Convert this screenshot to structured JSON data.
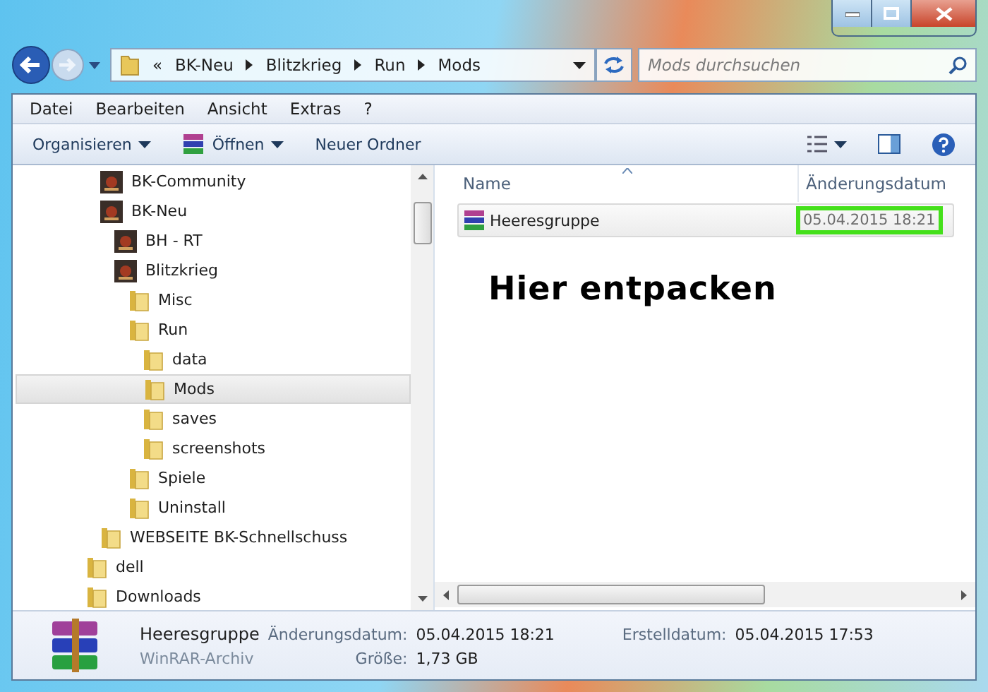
{
  "address_bar": {
    "overflow": "«",
    "crumbs": [
      "BK-Neu",
      "Blitzkrieg",
      "Run",
      "Mods"
    ]
  },
  "search": {
    "placeholder": "Mods durchsuchen"
  },
  "menu": [
    "Datei",
    "Bearbeiten",
    "Ansicht",
    "Extras",
    "?"
  ],
  "toolbar": [
    {
      "label": "Organisieren",
      "kind": "dropdown"
    },
    {
      "label": "Öffnen",
      "kind": "archive-dropdown"
    },
    {
      "label": "Neuer Ordner",
      "kind": "plain"
    }
  ],
  "tree": [
    {
      "children": [
        {
          "label": "BK-Community",
          "kind": "game",
          "selected": false
        },
        {
          "label": "BK-Neu",
          "kind": "game",
          "selected": false,
          "children": [
            {
              "label": "BH - RT",
              "kind": "game",
              "selected": false
            },
            {
              "label": "Blitzkrieg",
              "kind": "game",
              "selected": false,
              "children": [
                {
                  "label": "Misc",
                  "kind": "folder",
                  "selected": false
                },
                {
                  "label": "Run",
                  "kind": "folder",
                  "selected": false,
                  "children": [
                    {
                      "label": "data",
                      "kind": "folder",
                      "selected": false
                    },
                    {
                      "label": "Mods",
                      "kind": "folder",
                      "selected": true
                    },
                    {
                      "label": "saves",
                      "kind": "folder",
                      "selected": false
                    },
                    {
                      "label": "screenshots",
                      "kind": "folder",
                      "selected": false
                    }
                  ]
                },
                {
                  "label": "Spiele",
                  "kind": "folder",
                  "selected": false
                },
                {
                  "label": "Uninstall",
                  "kind": "folder",
                  "selected": false
                }
              ]
            }
          ]
        },
        {
          "label": "WEBSEITE BK-Schnellschuss",
          "kind": "folder",
          "selected": false
        }
      ]
    },
    {
      "label": "dell",
      "kind": "folder",
      "selected": false
    },
    {
      "label": "Downloads",
      "kind": "folder",
      "selected": false
    }
  ],
  "table": {
    "columns": [
      "Name",
      "Änderungsdatum"
    ],
    "rows": [
      {
        "name": "Heeresgruppe",
        "date": "05.04.2015 18:21",
        "date_marked": true
      }
    ]
  },
  "annotation": "Hier entpacken",
  "details": {
    "name": "Heeresgruppe",
    "type": "WinRAR-Archiv",
    "fields": [
      {
        "label": "Änderungsdatum:",
        "value": "05.04.2015 18:21"
      },
      {
        "label": "Erstelldatum:",
        "value": "05.04.2015 17:53"
      },
      {
        "label": "Größe:",
        "value": "1,73 GB"
      }
    ]
  }
}
